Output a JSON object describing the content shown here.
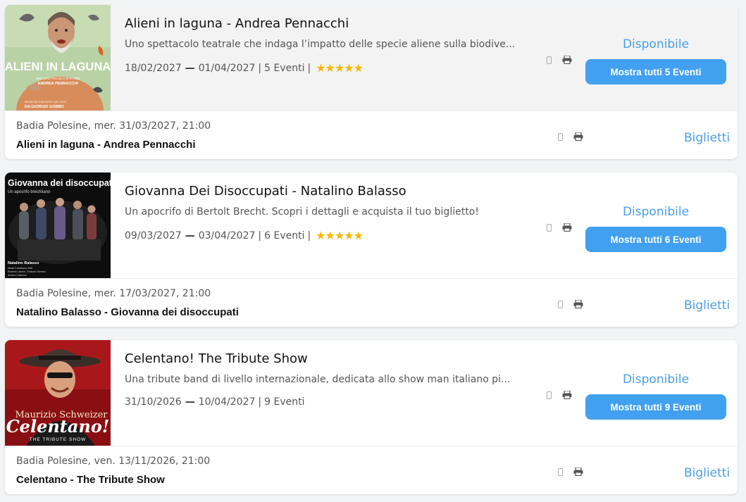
{
  "events": [
    {
      "title": "Alieni in laguna - Andrea Pennacchi",
      "description": "Uno spettacolo teatrale che indaga l’impatto delle specie aliene sulla biodive...",
      "date_start": "18/02/2027",
      "date_end": "01/04/2027",
      "events_count": "5 Eventi",
      "rating_stars": "★★★★★",
      "availability": "Disponibile",
      "show_all_label": "Mostra tutti 5 Eventi",
      "next_place_date": "Badia Polesine, mer. 31/03/2027, 21:00",
      "next_name": "Alieni in laguna - Andrea Pennacchi",
      "tickets_label": "Biglietti",
      "poster": {
        "title_text": "ALIENI IN LAGUNA",
        "sub_text": "UNO SPETTACOLO DI E CON",
        "author_text": "ANDREA PENNACCHI",
        "credit_line1": "MUSICHE ESEGUITE DAL VIVO",
        "credit_line2": "DA GIORGIO GOBBO"
      }
    },
    {
      "title": "Giovanna Dei Disoccupati - Natalino Balasso",
      "description": "Un apocrifo di Bertolt Brecht. Scopri i dettagli e acquista il tuo biglietto!",
      "date_start": "09/03/2027",
      "date_end": "03/04/2027",
      "events_count": "6 Eventi",
      "rating_stars": "★★★★★",
      "availability": "Disponibile",
      "show_all_label": "Mostra tutti 6 Eventi",
      "next_place_date": "Badia Polesine, mer. 17/03/2027, 21:00",
      "next_name": "Natalino Balasso - Giovanna dei disoccupati",
      "tickets_label": "Biglietti",
      "poster": {
        "title_text": "Giovanna dei disoccupati",
        "sub_text": "Un apocrifo brechtiano",
        "credit_line1": "Natalino Balasso",
        "credit_line2": "Marta Cortellazzo Wiel",
        "credit_line3": "Roberta Lanave, Graziano Sirressi",
        "credit_line4": "Andrea Collavino"
      }
    },
    {
      "title": "Celentano! The Tribute Show",
      "description": "Una tribute band di livello internazionale, dedicata allo show man italiano pi...",
      "date_start": "31/10/2026",
      "date_end": "10/04/2027",
      "events_count": "9 Eventi",
      "rating_stars": "",
      "availability": "Disponibile",
      "show_all_label": "Mostra tutti 9 Eventi",
      "next_place_date": "Badia Polesine, ven. 13/11/2026, 21:00",
      "next_name": "Celentano - The Tribute Show",
      "tickets_label": "Biglietti",
      "poster": {
        "author_text": "Maurizio Schweizer",
        "title_text": "Celentano!",
        "sub_text": "THE TRIBUTE SHOW"
      }
    }
  ],
  "colors": {
    "accent": "#41a0f0",
    "link": "#4a9de8",
    "star": "#f5b800",
    "page_bg": "#f2f3f5"
  },
  "icons": {
    "mobile": "mobile-phone-icon",
    "print": "printer-icon"
  }
}
